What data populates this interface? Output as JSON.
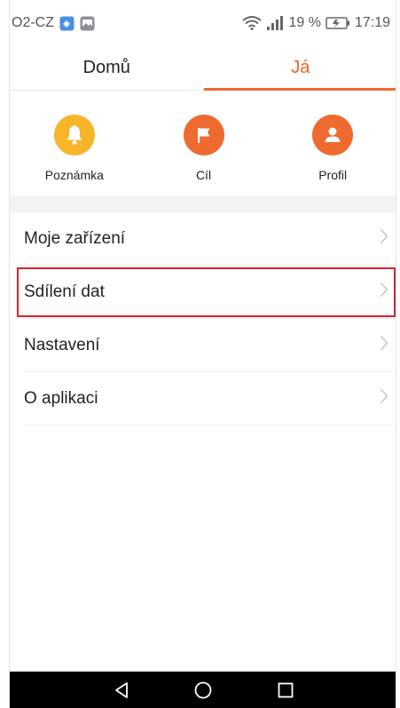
{
  "status_bar": {
    "carrier": "O2-CZ",
    "battery": "19 %",
    "time": "17:19"
  },
  "tabs": [
    {
      "label": "Domů",
      "active": false
    },
    {
      "label": "Já",
      "active": true
    }
  ],
  "quick_actions": [
    {
      "label": "Poznámka",
      "icon": "bell-icon",
      "color": "#f7b52a"
    },
    {
      "label": "Cíl",
      "icon": "flag-icon",
      "color": "#ee6a2f"
    },
    {
      "label": "Profil",
      "icon": "person-icon",
      "color": "#ee6a2f"
    }
  ],
  "menu": [
    {
      "label": "Moje zařízení"
    },
    {
      "label": "Sdílení dat",
      "highlighted": true
    },
    {
      "label": "Nastavení"
    },
    {
      "label": "O aplikaci"
    }
  ],
  "colors": {
    "accent": "#ee6a2f",
    "yellow": "#f7b52a",
    "highlight_border": "#d9232e"
  }
}
